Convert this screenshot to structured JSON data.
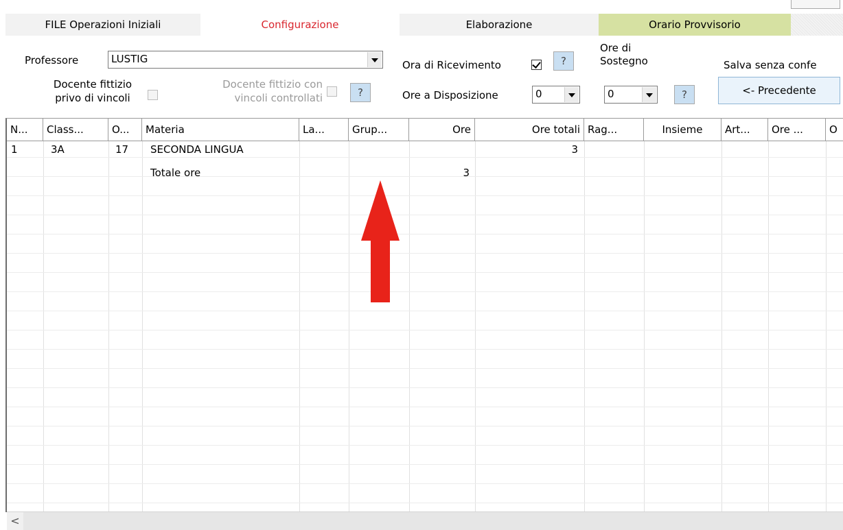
{
  "tabs": [
    {
      "label": "FILE Operazioni Iniziali"
    },
    {
      "label": "Configurazione"
    },
    {
      "label": "Elaborazione"
    },
    {
      "label": "Orario Provvisorio"
    }
  ],
  "form": {
    "professore_label": "Professore",
    "professore_value": "LUSTIG",
    "docente_fittizio_label_1": "Docente fittizio",
    "docente_fittizio_label_2": "privo di vincoli",
    "docente_fittizio_con_label_1": "Docente fittizio con",
    "docente_fittizio_con_label_2": "vincoli controllati",
    "help_label": "?",
    "ora_ricevimento_label": "Ora di Ricevimento",
    "ora_ricevimento_checked": true,
    "ore_disposizione_label": "Ore a Disposizione",
    "ore_disposizione_value": "0",
    "ore_sostegno_label_1": "Ore di",
    "ore_sostegno_label_2": "Sostegno",
    "ore_sostegno_value": "0",
    "salva_label": "Salva senza confe",
    "precedente_label": "<- Precedente"
  },
  "grid": {
    "columns": [
      "N...",
      "Class...",
      "O...",
      "Materia",
      "La...",
      "Grup...",
      "Ore",
      "Ore totali",
      "Rag...",
      "Insieme",
      "Art...",
      "Ore ...",
      "O"
    ],
    "rows": [
      {
        "n": "1",
        "classe": "3A",
        "o": "17",
        "materia": "SECONDA LINGUA",
        "ore": "",
        "ore_totali": "3"
      },
      {
        "n": "",
        "classe": "",
        "o": "",
        "materia": "Totale ore",
        "ore": "3",
        "ore_totali": ""
      }
    ]
  },
  "scroll": {
    "left_arrow": "<"
  },
  "colors": {
    "active_tab": "#d9262e",
    "orario_tab": "#d6e1a2",
    "annotation_arrow": "#e8231a"
  },
  "icons": {
    "annotation": "red-up-arrow-icon"
  }
}
